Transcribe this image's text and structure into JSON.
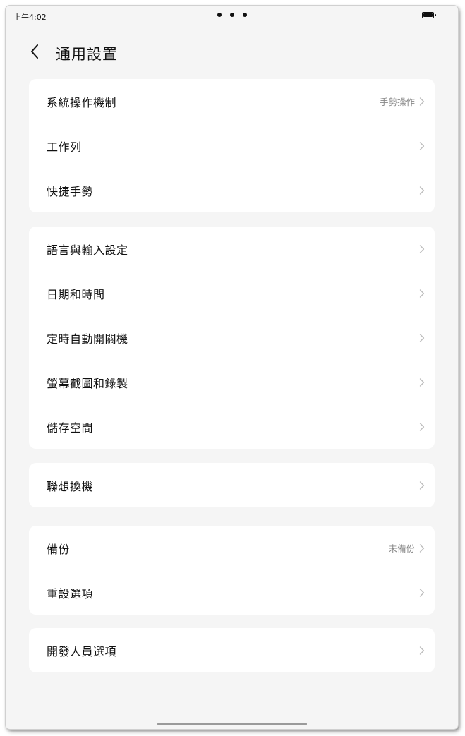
{
  "status_bar": {
    "time": "上午4:02",
    "icons": [
      "more-dots-icon",
      "battery-icon"
    ]
  },
  "header": {
    "back_icon": "chevron-left-icon",
    "title": "通用設置"
  },
  "groups": [
    {
      "items": [
        {
          "label": "系統操作機制",
          "value": "手勢操作"
        },
        {
          "label": "工作列",
          "value": ""
        },
        {
          "label": "快捷手勢",
          "value": ""
        }
      ]
    },
    {
      "items": [
        {
          "label": "語言與輸入設定",
          "value": ""
        },
        {
          "label": "日期和時間",
          "value": ""
        },
        {
          "label": "定時自動開關機",
          "value": ""
        },
        {
          "label": "螢幕截圖和錄製",
          "value": ""
        },
        {
          "label": "儲存空間",
          "value": ""
        }
      ]
    },
    {
      "items": [
        {
          "label": "聯想換機",
          "value": ""
        }
      ]
    },
    {
      "items": [
        {
          "label": "備份",
          "value": "未備份"
        },
        {
          "label": "重設選項",
          "value": ""
        }
      ]
    },
    {
      "items": [
        {
          "label": "開發人員選項",
          "value": ""
        }
      ]
    }
  ],
  "colors": {
    "background": "#f5f5f5",
    "card": "#ffffff",
    "text": "#111111",
    "secondary_text": "#888888",
    "chevron": "#bbbbbb"
  }
}
